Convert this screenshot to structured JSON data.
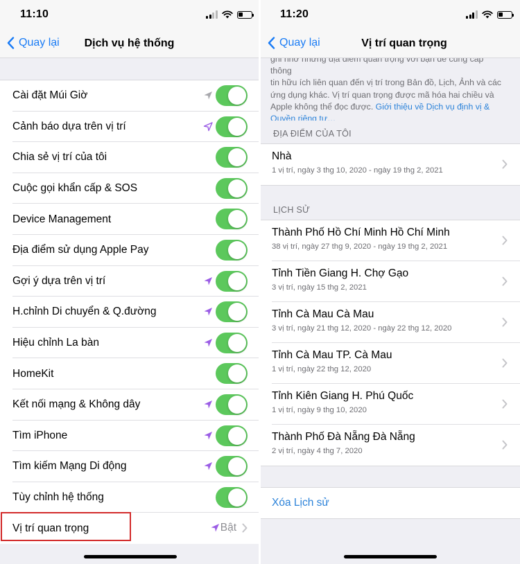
{
  "left": {
    "status_time": "11:10",
    "back_label": "Quay lại",
    "title": "Dịch vụ hệ thống",
    "rows": [
      {
        "label": "Cài đặt Múi Giờ",
        "arrow": "gray",
        "toggle": true
      },
      {
        "label": "Cảnh báo dựa trên vị trí",
        "arrow": "purple-outline",
        "toggle": true
      },
      {
        "label": "Chia sẻ vị trí của tôi",
        "arrow": "",
        "toggle": true
      },
      {
        "label": "Cuộc gọi khẩn cấp & SOS",
        "arrow": "",
        "toggle": true
      },
      {
        "label": "Device Management",
        "arrow": "",
        "toggle": true
      },
      {
        "label": "Địa điểm sử dụng Apple Pay",
        "arrow": "",
        "toggle": true
      },
      {
        "label": "Gợi ý dựa trên vị trí",
        "arrow": "purple",
        "toggle": true
      },
      {
        "label": "H.chỉnh Di chuyển & Q.đường",
        "arrow": "purple",
        "toggle": true
      },
      {
        "label": "Hiệu chỉnh La bàn",
        "arrow": "purple",
        "toggle": true
      },
      {
        "label": "HomeKit",
        "arrow": "",
        "toggle": true
      },
      {
        "label": "Kết nối mạng & Không dây",
        "arrow": "purple",
        "toggle": true
      },
      {
        "label": "Tìm iPhone",
        "arrow": "purple",
        "toggle": true
      },
      {
        "label": "Tìm kiếm Mạng Di động",
        "arrow": "purple",
        "toggle": true
      },
      {
        "label": "Tùy chỉnh hệ thống",
        "arrow": "",
        "toggle": true
      },
      {
        "label": "Vị trí quan trọng",
        "arrow": "purple",
        "toggle": false,
        "value": "Bật"
      }
    ]
  },
  "right": {
    "status_time": "11:20",
    "back_label": "Quay lại",
    "title": "Vị trí quan trọng",
    "intro_lines": [
      "ghi nhớ những địa điểm quan trọng với bạn để cung cấp thông",
      "tin hữu ích liên quan đến vị trí trong Bản đồ, Lịch, Ảnh và các",
      "ứng dụng khác. Vị trí quan trọng được mã hóa hai chiều và"
    ],
    "intro_last": "Apple không thể đọc được.",
    "intro_link_1": "Giới thiệu về Dịch vụ định vị &",
    "intro_link_2": "Quyền riêng tư…",
    "section_my_places": "ĐỊA ĐIỂM CỦA TÔI",
    "my_places": [
      {
        "title": "Nhà",
        "subtitle": "1 vị trí, ngày 3 thg 10, 2020 - ngày 19 thg 2, 2021"
      }
    ],
    "section_history": "LỊCH SỬ",
    "history": [
      {
        "title": "Thành Phố Hồ Chí Minh Hồ Chí Minh",
        "subtitle": "38 vị trí, ngày 27 thg 9, 2020 - ngày 19 thg 2, 2021"
      },
      {
        "title": "Tỉnh Tiền Giang H. Chợ Gạo",
        "subtitle": "3 vị trí, ngày 15 thg 2, 2021"
      },
      {
        "title": "Tỉnh Cà Mau Cà Mau",
        "subtitle": "3 vị trí, ngày 21 thg 12, 2020 - ngày 22 thg 12, 2020"
      },
      {
        "title": "Tỉnh Cà Mau TP. Cà Mau",
        "subtitle": "1 vị trí, ngày 22 thg 12, 2020"
      },
      {
        "title": "Tỉnh Kiên Giang H. Phú Quốc",
        "subtitle": "1 vị trí, ngày 9 thg 10, 2020"
      },
      {
        "title": "Thành Phố Đà Nẵng Đà Nẵng",
        "subtitle": "2 vị trí, ngày 4 thg 7, 2020"
      }
    ],
    "clear_history": "Xóa Lịch sử"
  },
  "colors": {
    "accent_blue": "#1a7cf6",
    "toggle_green": "#5cc85c",
    "location_purple": "#9b5de5",
    "highlight_red": "#d22a2a"
  }
}
